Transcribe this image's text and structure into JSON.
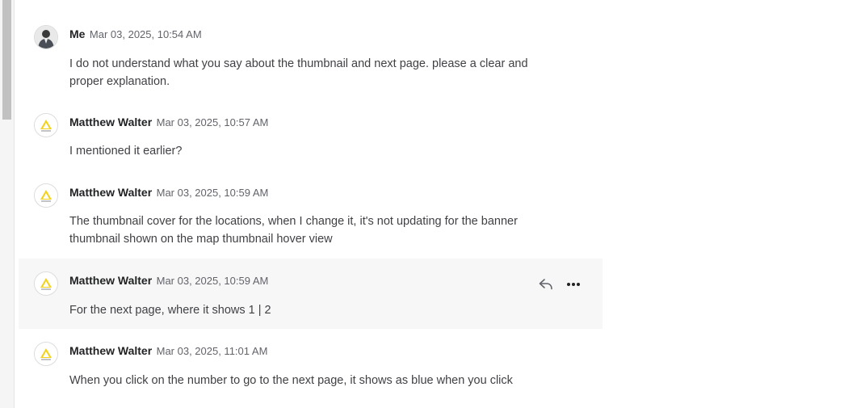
{
  "messages": [
    {
      "author": "Me",
      "time": "Mar 03, 2025, 10:54 AM",
      "text": "I do not understand what you say about the thumbnail and next page. please a clear and proper explanation.",
      "avatar": "user-photo"
    },
    {
      "author": "Matthew Walter",
      "time": "Mar 03, 2025, 10:57 AM",
      "text": "I mentioned it earlier?",
      "avatar": "company-logo"
    },
    {
      "author": "Matthew Walter",
      "time": "Mar 03, 2025, 10:59 AM",
      "text": "The thumbnail cover for the locations, when I change it, it's not updating for the banner thumbnail shown on the map thumbnail hover view",
      "avatar": "company-logo"
    },
    {
      "author": "Matthew Walter",
      "time": "Mar 03, 2025, 10:59 AM",
      "text": "For the next page, where it shows 1 | 2",
      "avatar": "company-logo",
      "hovered": true
    },
    {
      "author": "Matthew Walter",
      "time": "Mar 03, 2025, 11:01 AM",
      "text": "When you click on the number to go to the next page, it shows as blue when you click",
      "avatar": "company-logo"
    }
  ],
  "icons": {
    "reply": "reply-icon",
    "more": "more-options-icon"
  },
  "colors": {
    "logo_yellow": "#f2d21b",
    "hover_background": "#f7f7f7",
    "author_text": "#222325",
    "body_text": "#404145"
  }
}
